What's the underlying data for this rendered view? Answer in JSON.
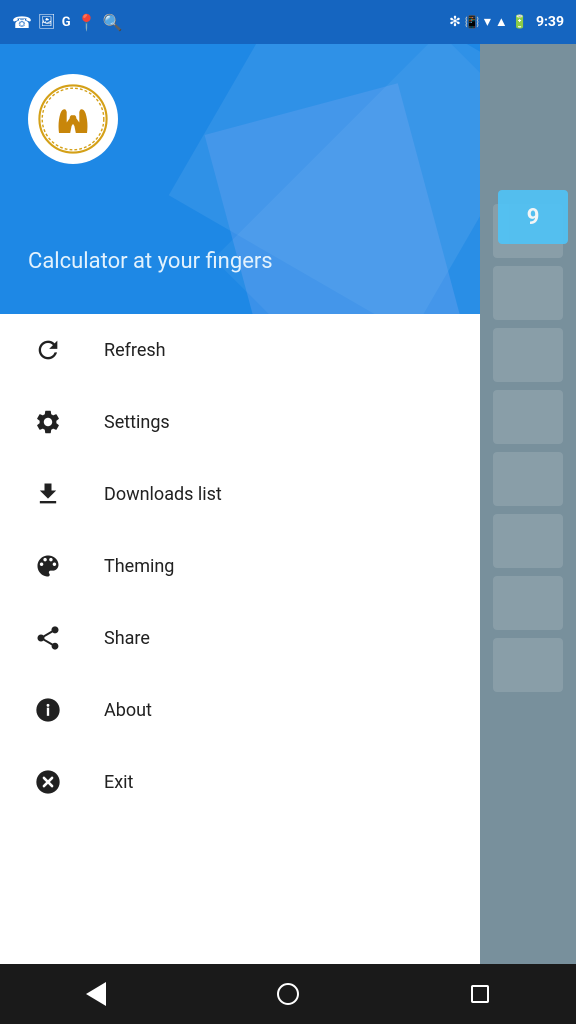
{
  "statusBar": {
    "time": "9:39"
  },
  "header": {
    "title": "Calculator at your fingers",
    "logoAlt": "Lift-Up-Pro Consulting Group Logo"
  },
  "menu": {
    "items": [
      {
        "id": "refresh",
        "label": "Refresh",
        "icon": "refresh-icon"
      },
      {
        "id": "settings",
        "label": "Settings",
        "icon": "settings-icon"
      },
      {
        "id": "downloads",
        "label": "Downloads list",
        "icon": "download-icon"
      },
      {
        "id": "theming",
        "label": "Theming",
        "icon": "palette-icon"
      },
      {
        "id": "share",
        "label": "Share",
        "icon": "share-icon"
      },
      {
        "id": "about",
        "label": "About",
        "icon": "info-icon"
      },
      {
        "id": "exit",
        "label": "Exit",
        "icon": "close-icon"
      }
    ]
  },
  "navBar": {
    "back": "back-button",
    "home": "home-button",
    "recent": "recent-apps-button"
  }
}
